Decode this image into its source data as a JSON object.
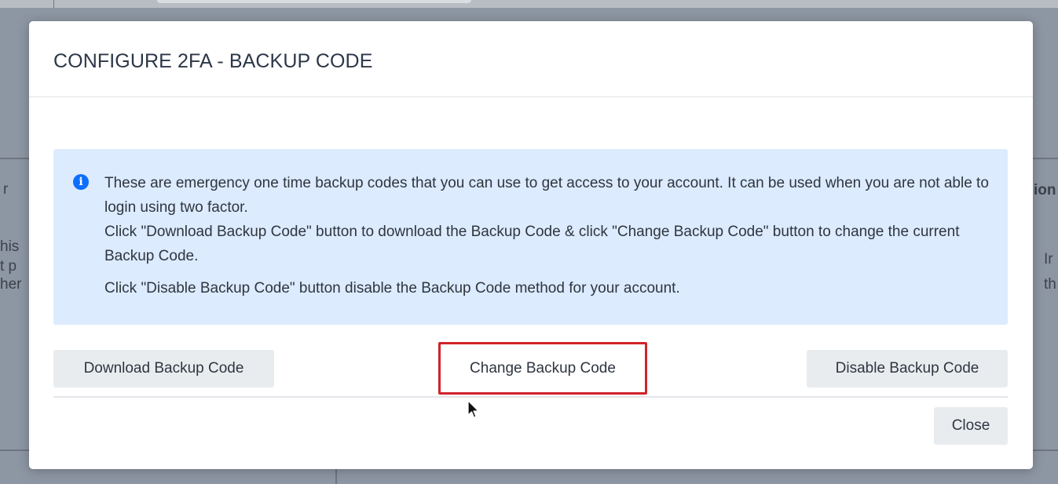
{
  "background": {
    "fragments_left": [
      "r",
      "his",
      "t p",
      "her"
    ],
    "fragments_right": [
      "ion",
      "Ir",
      "th"
    ]
  },
  "modal": {
    "title": "CONFIGURE 2FA - BACKUP CODE",
    "info": {
      "icon": "info-circle-icon",
      "line1": "These are emergency one time backup codes that you can use to get access to your account. It can be used when you are not able to login using two factor.",
      "line2": "Click \"Download Backup Code\" button to download the Backup Code & click \"Change Backup Code\" button to change the current Backup Code.",
      "line3": "Click \"Disable Backup Code\" button disable the Backup Code method for your account."
    },
    "buttons": {
      "download": "Download Backup Code",
      "change": "Change Backup Code",
      "disable": "Disable Backup Code",
      "close": "Close"
    }
  },
  "colors": {
    "highlight_border": "#d1232a",
    "info_background": "#dcebfd",
    "info_icon": "#0d6efd",
    "overlay": "#8d96a3"
  }
}
